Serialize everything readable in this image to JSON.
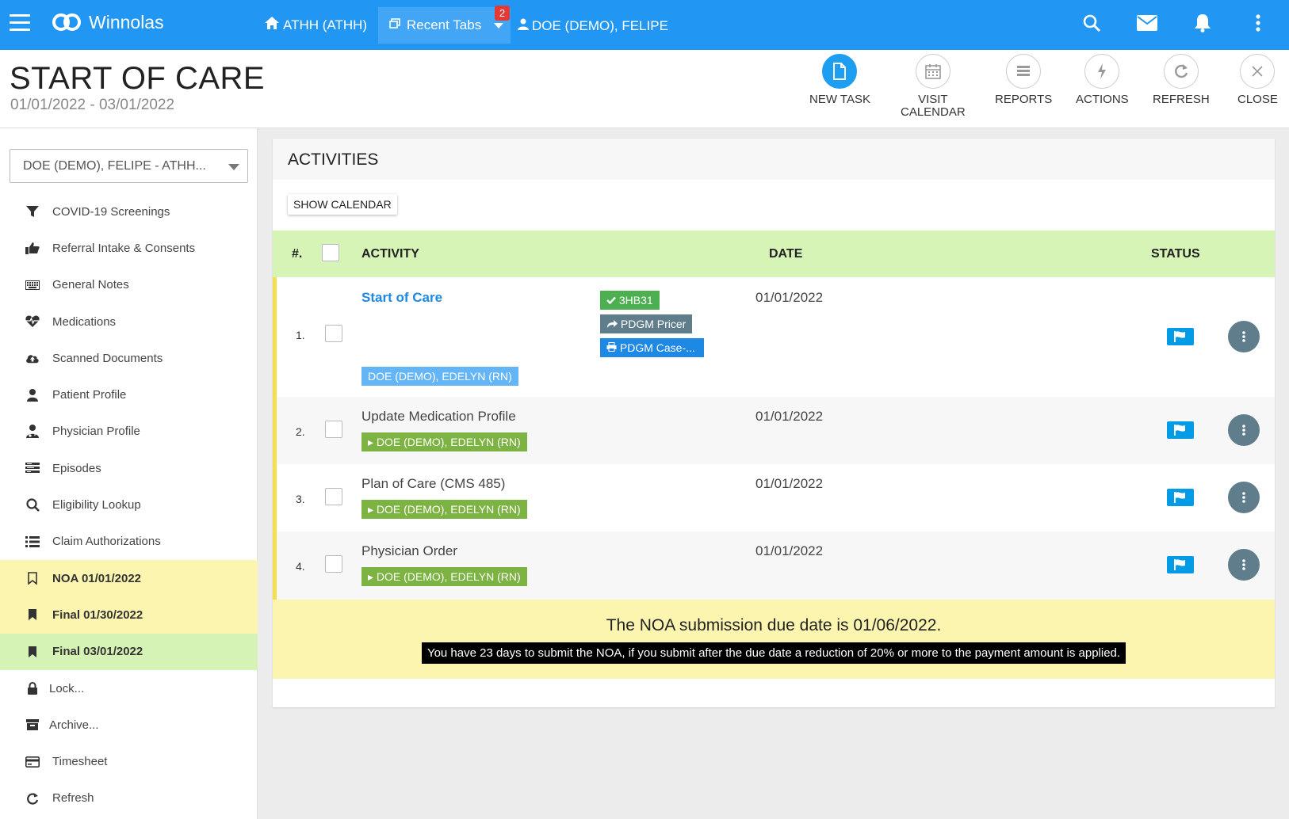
{
  "topbar": {
    "brand": "Winnolas",
    "home": "ATHH (ATHH)",
    "recent_tabs": "Recent Tabs",
    "recent_count": "2",
    "patient": "DOE (DEMO), FELIPE"
  },
  "header": {
    "title": "START OF CARE",
    "dates": "01/01/2022 - 03/01/2022",
    "toolbar": {
      "new_task": "NEW TASK",
      "visit_calendar_1": "VISIT",
      "visit_calendar_2": "CALENDAR",
      "reports": "REPORTS",
      "actions": "ACTIONS",
      "refresh": "REFRESH",
      "close": "CLOSE"
    }
  },
  "sidebar": {
    "selected_patient": "DOE (DEMO), FELIPE - ATHH...",
    "items": [
      {
        "label": "COVID-19 Screenings",
        "icon": "filter-icon"
      },
      {
        "label": "Referral Intake & Consents",
        "icon": "thumbs-up-icon"
      },
      {
        "label": "General Notes",
        "icon": "keyboard-icon"
      },
      {
        "label": "Medications",
        "icon": "heartbeat-icon"
      },
      {
        "label": "Scanned Documents",
        "icon": "cloud-upload-icon"
      },
      {
        "label": "Patient Profile",
        "icon": "user-icon"
      },
      {
        "label": "Physician Profile",
        "icon": "doctor-icon"
      },
      {
        "label": "Episodes",
        "icon": "list-box-icon"
      },
      {
        "label": "Eligibility Lookup",
        "icon": "search-icon"
      },
      {
        "label": "Claim Authorizations",
        "icon": "list-icon"
      },
      {
        "label": "NOA 01/01/2022",
        "icon": "bookmark-outline-icon"
      },
      {
        "label": "Final 01/30/2022",
        "icon": "bookmark-icon"
      },
      {
        "label": "Final 03/01/2022",
        "icon": "bookmark-icon"
      },
      {
        "label": "Lock...",
        "icon": "lock-icon"
      },
      {
        "label": "Archive...",
        "icon": "archive-icon"
      },
      {
        "label": "Timesheet",
        "icon": "credit-card-icon"
      },
      {
        "label": "Refresh",
        "icon": "refresh-icon"
      }
    ]
  },
  "activities": {
    "heading": "ACTIVITIES",
    "show_calendar": "SHOW CALENDAR",
    "columns": {
      "num": "#.",
      "activity": "ACTIVITY",
      "date": "DATE",
      "status": "STATUS"
    },
    "rows": [
      {
        "num": "1.",
        "title": "Start of Care",
        "date": "01/01/2022",
        "assignee": "DOE (DEMO), EDELYN (RN)",
        "code": "3HB31",
        "pricer": "PDGM Pricer",
        "casemix": "PDGM Case-..."
      },
      {
        "num": "2.",
        "title": "Update Medication Profile",
        "date": "01/01/2022",
        "assignee": "DOE (DEMO), EDELYN (RN)"
      },
      {
        "num": "3.",
        "title": "Plan of Care (CMS 485)",
        "date": "01/01/2022",
        "assignee": "DOE (DEMO), EDELYN (RN)"
      },
      {
        "num": "4.",
        "title": "Physician Order",
        "date": "01/01/2022",
        "assignee": "DOE (DEMO), EDELYN (RN)"
      }
    ],
    "noa_message": "The NOA submission due date is 01/06/2022.",
    "noa_note": "You have 23 days to submit the NOA, if you submit after the due date a reduction of 20% or more to the payment amount is applied."
  },
  "colors": {
    "brand_blue": "#2196f3",
    "header_row_green": "#d5f4b6",
    "noa_yellow": "#fcf5b0",
    "tag_green": "#7cb342",
    "code_green": "#4caf50",
    "pricer_gray": "#607d8b",
    "casemix_blue": "#1e88e5"
  }
}
